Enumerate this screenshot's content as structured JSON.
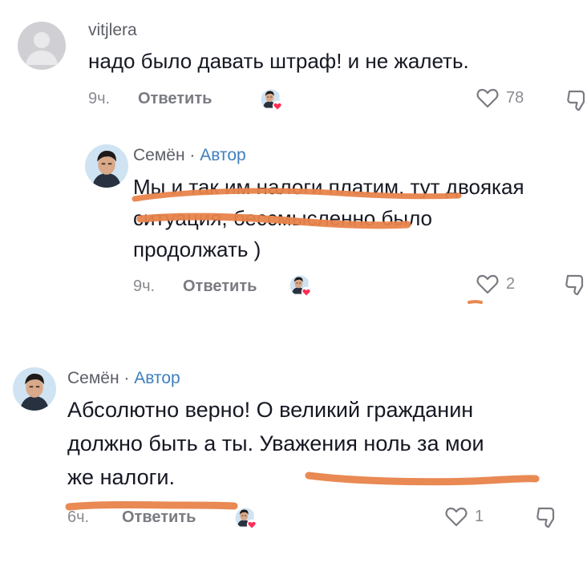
{
  "comments": [
    {
      "username": "vitjlera",
      "text": "надо было давать штраф! и не жалеть.",
      "time": "9ч.",
      "reply_label": "Ответить",
      "likes": "78"
    },
    {
      "username": "Семён",
      "separator": " · ",
      "author_badge": "Автор",
      "text_lines": [
        "Мы и так им налоги платим, тут двоякая",
        "ситуация, бессмысленно было",
        "продолжать )"
      ],
      "time": "9ч.",
      "reply_label": "Ответить",
      "likes": "2"
    },
    {
      "username": "Семён",
      "separator": " · ",
      "author_badge": "Автор",
      "text_lines": [
        "Абсолютно верно! О великий гражданин",
        "должно быть а ты. Уважения ноль за мои",
        "же налоги."
      ],
      "time": "6ч.",
      "reply_label": "Ответить",
      "likes": "1"
    }
  ],
  "icons": {
    "like": "heart-outline-icon",
    "dislike": "thumbs-down-outline-icon",
    "creator_liked": "creator-heart-avatar-icon"
  },
  "colors": {
    "author_badge": "#3f7fbf",
    "scribble": "#e8834a",
    "heart_badge": "#fe2c55"
  }
}
